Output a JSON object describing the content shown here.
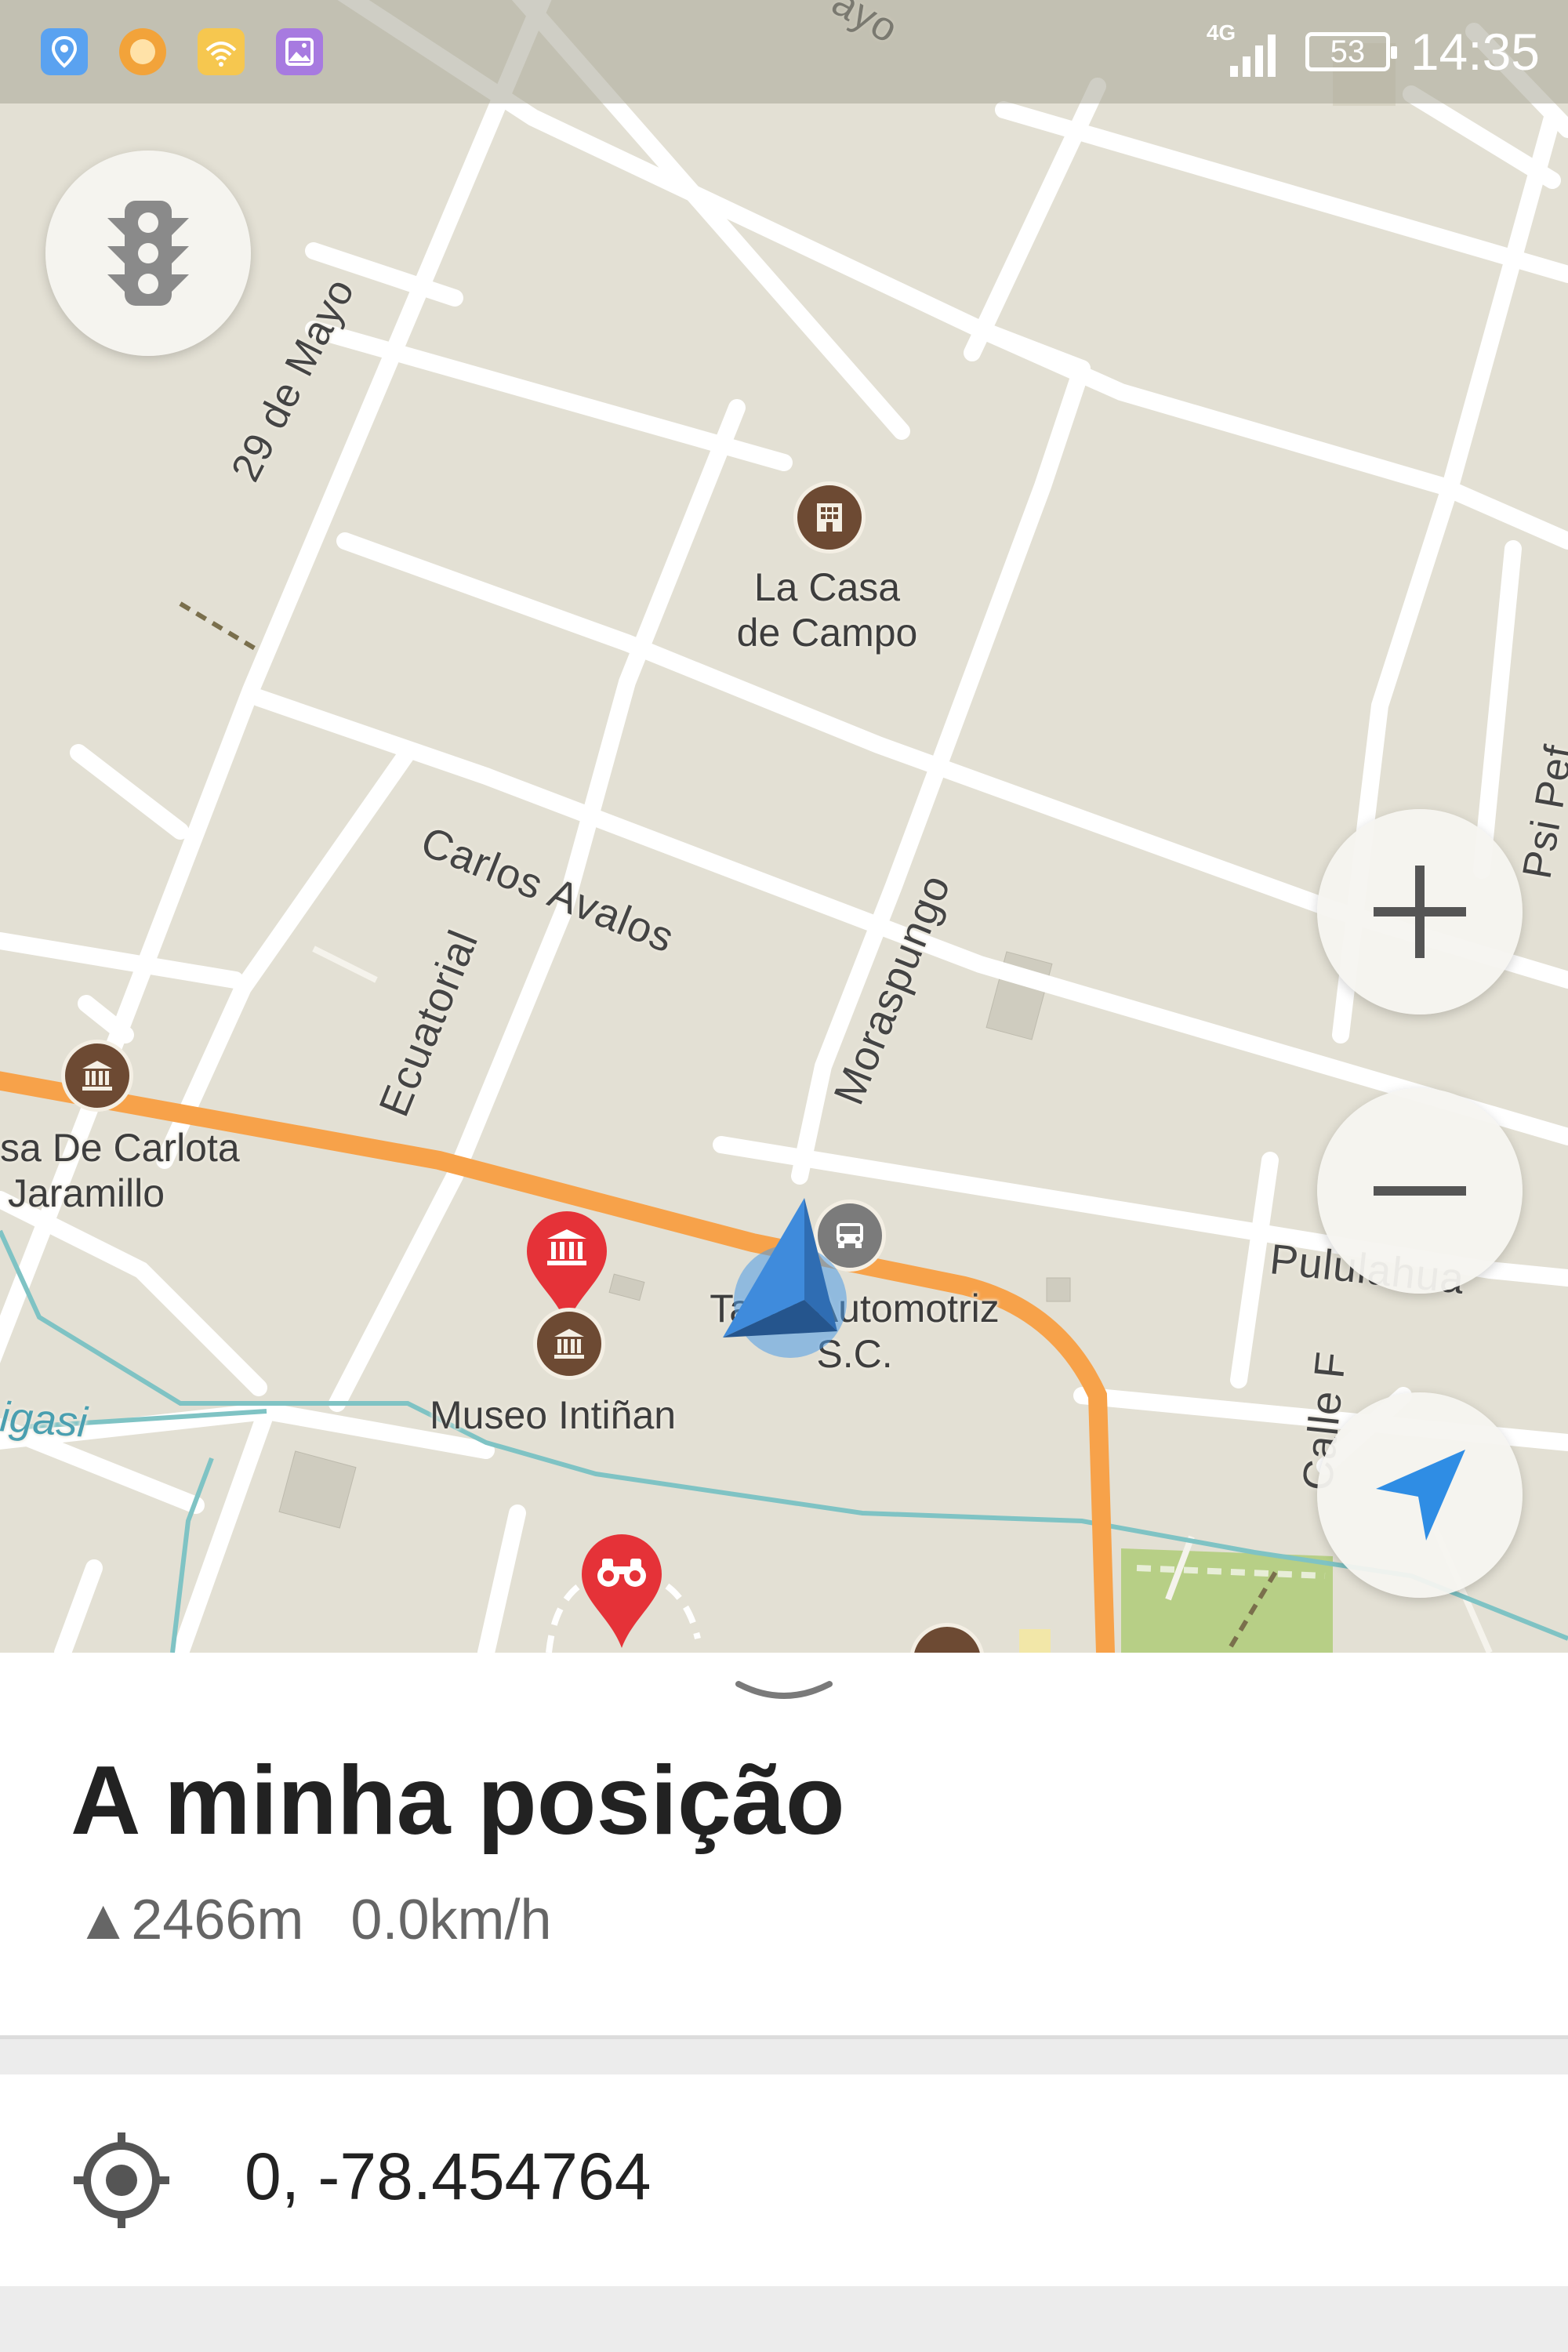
{
  "status_bar": {
    "network": "4G",
    "battery": "53",
    "time": "14:35",
    "notification_icons": [
      "maps-notification-icon",
      "orange-app-icon",
      "wifi-share-icon",
      "gallery-icon"
    ]
  },
  "map": {
    "streets": {
      "top": "ayo",
      "mayo": "29 de Mayo",
      "carlos": "Carlos Avalos",
      "ecuatorial": "Ecuatorial",
      "moraspungo": "Moraspungo",
      "pululahua": "Pululahua",
      "calle_f": "Calle F",
      "psi": "Psi Pef",
      "ingasi": "igasi"
    },
    "places": {
      "casa_campo": [
        "La Casa",
        "de Campo"
      ],
      "carlota": [
        "sa De Carlota",
        "Jaramillo"
      ],
      "museo": "Museo Intiñan",
      "taller": [
        "Taller Automotriz",
        "S.C."
      ]
    },
    "colors": {
      "land": "#e3e0d4",
      "road": "#ffffff",
      "main_road": "#f7a24a",
      "water": "#7fc3c4",
      "park": "#b7cf86",
      "poi_brown": "#6d4a33",
      "pin_red": "#e53238",
      "nav_blue": "#2f8de4"
    }
  },
  "controls": {
    "traffic_button": "traffic-light-icon",
    "zoom_in": "+",
    "zoom_out": "−",
    "my_location": "navigate-arrow-icon"
  },
  "sheet": {
    "title": "A minha posição",
    "altitude": "▲2466m",
    "speed": "0.0km/h",
    "coordinates": "0, -78.454764"
  }
}
